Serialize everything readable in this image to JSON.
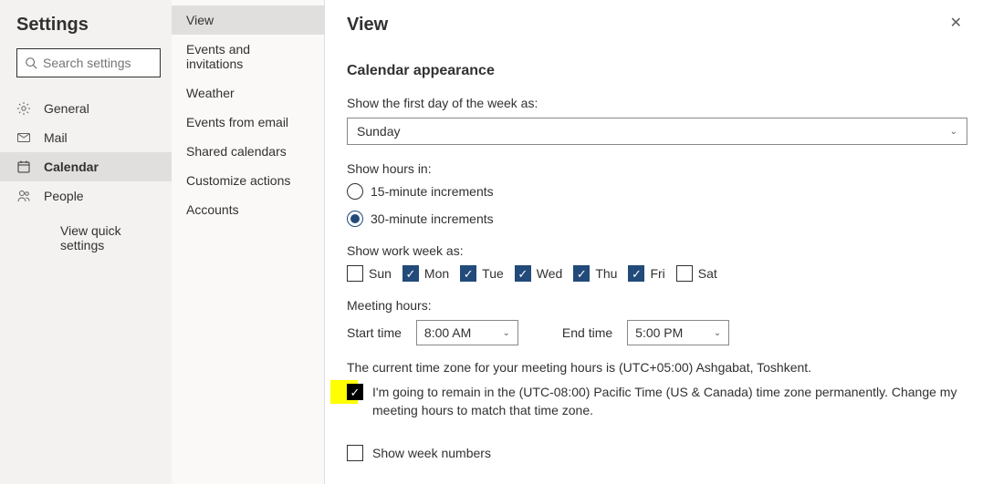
{
  "left": {
    "title": "Settings",
    "search_placeholder": "Search settings",
    "nav": [
      {
        "key": "general",
        "label": "General",
        "icon": "gear",
        "active": false
      },
      {
        "key": "mail",
        "label": "Mail",
        "icon": "mail",
        "active": false
      },
      {
        "key": "calendar",
        "label": "Calendar",
        "icon": "calendar",
        "active": true
      },
      {
        "key": "people",
        "label": "People",
        "icon": "people",
        "active": false
      }
    ],
    "quick_link": "View quick settings"
  },
  "mid": {
    "items": [
      {
        "key": "view",
        "label": "View",
        "active": true
      },
      {
        "key": "events-invitations",
        "label": "Events and invitations",
        "active": false
      },
      {
        "key": "weather",
        "label": "Weather",
        "active": false
      },
      {
        "key": "events-from-email",
        "label": "Events from email",
        "active": false
      },
      {
        "key": "shared-calendars",
        "label": "Shared calendars",
        "active": false
      },
      {
        "key": "customize-actions",
        "label": "Customize actions",
        "active": false
      },
      {
        "key": "accounts",
        "label": "Accounts",
        "active": false
      }
    ]
  },
  "right": {
    "title": "View",
    "section_title": "Calendar appearance",
    "first_day_label": "Show the first day of the week as:",
    "first_day_value": "Sunday",
    "show_hours_label": "Show hours in:",
    "radio_15": "15-minute increments",
    "radio_30": "30-minute increments",
    "radio_selected": "30",
    "work_week_label": "Show work week as:",
    "days": [
      {
        "abbr": "Sun",
        "checked": false
      },
      {
        "abbr": "Mon",
        "checked": true
      },
      {
        "abbr": "Tue",
        "checked": true
      },
      {
        "abbr": "Wed",
        "checked": true
      },
      {
        "abbr": "Thu",
        "checked": true
      },
      {
        "abbr": "Fri",
        "checked": true
      },
      {
        "abbr": "Sat",
        "checked": false
      }
    ],
    "meeting_hours_label": "Meeting hours:",
    "start_label": "Start time",
    "start_value": "8:00 AM",
    "end_label": "End time",
    "end_value": "5:00 PM",
    "tz_text": "The current time zone for your meeting hours is (UTC+05:00) Ashgabat, Toshkent.",
    "remain_text": "I'm going to remain in the (UTC-08:00) Pacific Time (US & Canada) time zone permanently. Change my meeting hours to match that time zone.",
    "remain_checked": true,
    "week_numbers_label": "Show week numbers",
    "week_numbers_checked": false
  }
}
